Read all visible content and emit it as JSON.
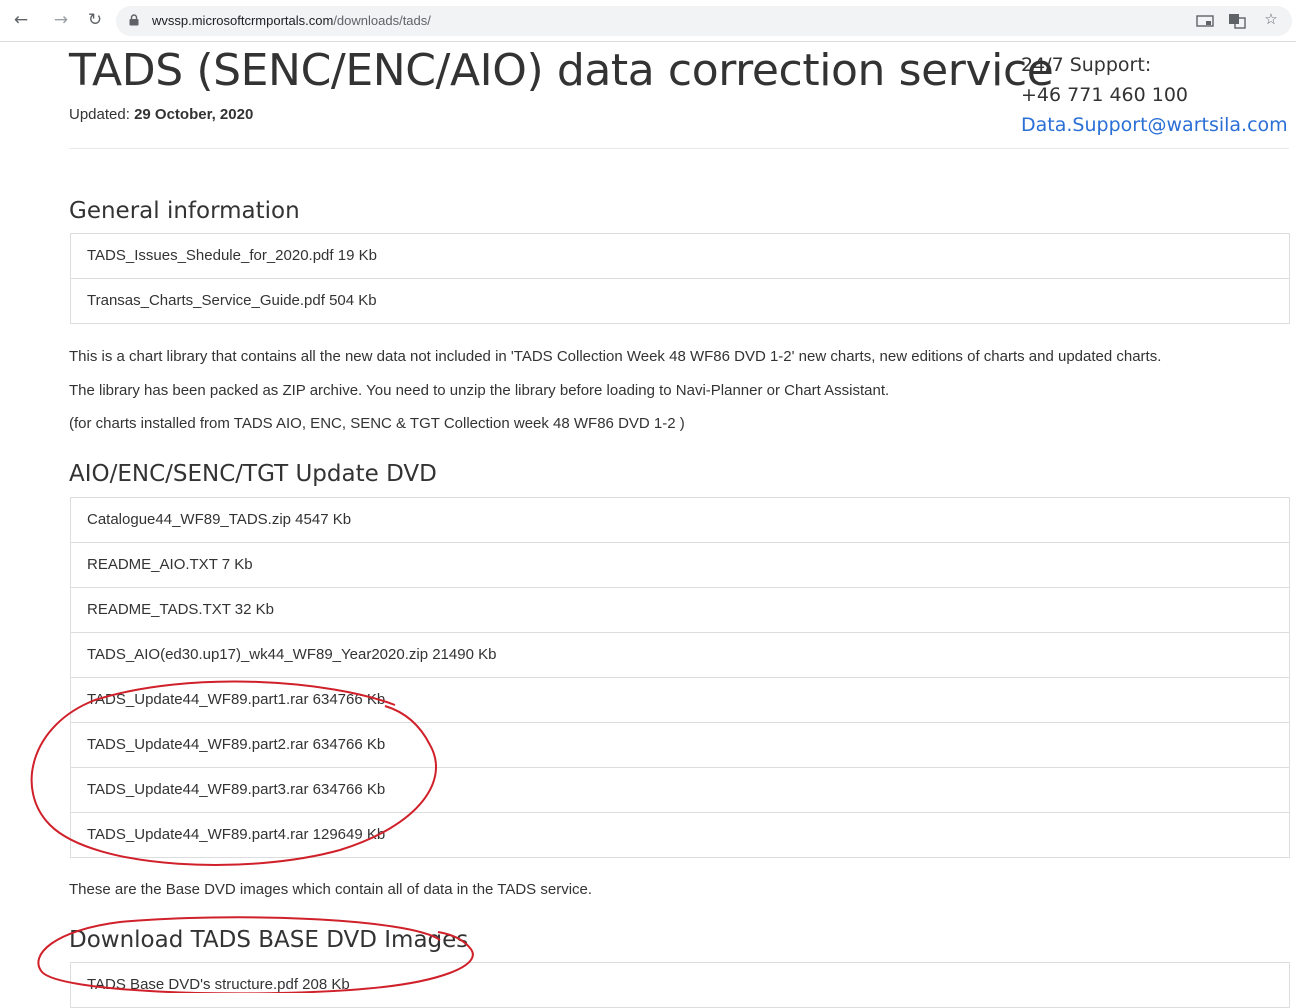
{
  "browser": {
    "url_host": "wvssp.microsoftcrmportals.com",
    "url_path": "/downloads/tads/"
  },
  "header": {
    "title": "TADS (SENC/ENC/AIO) data correction service",
    "updated_label": "Updated:",
    "updated_date": "29 October, 2020",
    "support_label": "24/7 Support:",
    "support_phone": "+46 771 460 100",
    "support_email": "Data.Support@wartsila.com"
  },
  "sections": {
    "general": {
      "heading": "General information",
      "files": [
        "TADS_Issues_Shedule_for_2020.pdf 19 Kb",
        "Transas_Charts_Service_Guide.pdf 504 Kb"
      ]
    },
    "intro": [
      "This is a chart library that contains all the new data not included in 'TADS Collection Week 48 WF86 DVD 1-2' new charts, new editions of charts and updated charts.",
      "The library has been packed as ZIP archive. You need to unzip the library before loading to Navi-Planner or Chart Assistant.",
      "(for charts installed from TADS AIO, ENC, SENC & TGT Collection week 48 WF86 DVD 1-2 )"
    ],
    "update": {
      "heading": "AIO/ENC/SENC/TGT Update DVD",
      "files": [
        "Catalogue44_WF89_TADS.zip 4547 Kb",
        "README_AIO.TXT 7 Kb",
        "README_TADS.TXT 32 Kb",
        "TADS_AIO(ed30.up17)_wk44_WF89_Year2020.zip 21490 Kb",
        "TADS_Update44_WF89.part1.rar 634766 Kb",
        "TADS_Update44_WF89.part2.rar 634766 Kb",
        "TADS_Update44_WF89.part3.rar 634766 Kb",
        "TADS_Update44_WF89.part4.rar 129649 Kb"
      ]
    },
    "base_note": "These are the Base DVD images which contain all of data in the TADS service.",
    "base": {
      "heading": "Download TADS BASE DVD Images",
      "files": [
        "TADS Base DVD's structure.pdf 208 Kb"
      ]
    }
  },
  "colors": {
    "link": "#2a6fd6",
    "annotation": "#d0202a",
    "border": "#dddddd"
  }
}
